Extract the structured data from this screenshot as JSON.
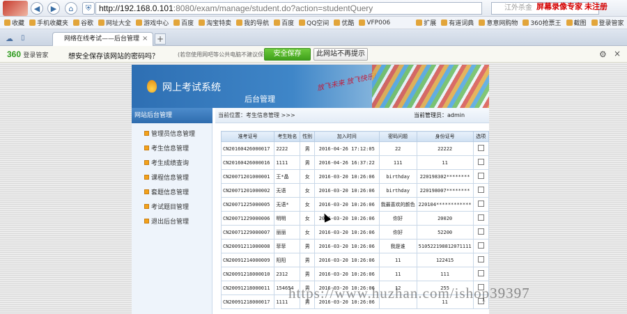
{
  "browser": {
    "url_host": "http://192.168.0.101",
    "url_rest": ":8080/exam/manage/student.do?action=studentQuery",
    "search_placeholder": "江外杀金",
    "watermark_top": "屏幕录像专家 未注册"
  },
  "bookmarks": [
    "收藏",
    "手机收藏夹",
    "谷歌",
    "网址大全",
    "游戏中心",
    "百度",
    "淘宝特卖",
    "我的导航",
    "百度",
    "QQ空间",
    "优酷",
    "VFP006",
    "扩展",
    "有道词典",
    "意意网购物",
    "360抢票王",
    "截图",
    "登录管家"
  ],
  "tab": {
    "title": "网络在线考试——后台管理",
    "close": "×",
    "new": "+"
  },
  "password_bar": {
    "brand": "360",
    "brand_sub": "登录管家",
    "question": "想安全保存该网站的密码吗？",
    "hint": "(若您使用网吧等公共电脑不建议保存)",
    "save_label": "安全保存",
    "never_label": "此网站不再提示"
  },
  "site": {
    "system_name": "网上考试系统",
    "backend_name": "后台管理",
    "slogan": "放飞未来 放飞快乐!",
    "menu_title": "网站后台管理",
    "menu": [
      "管理员信息管理",
      "考生信息管理",
      "考生成绩查询",
      "课程信息管理",
      "套题信息管理",
      "考试题目管理",
      "退出后台管理"
    ],
    "breadcrumb": "当前位置：考生信息管理 >>>",
    "admin": "当前管理员：admin"
  },
  "table": {
    "headers": [
      "准考证号",
      "考生姓名",
      "性别",
      "加入时间",
      "密码问题",
      "身份证号",
      "选项"
    ],
    "rows": [
      [
        "CN20160426000017",
        "2222",
        "男",
        "2016-04-26 17:12:05",
        "22",
        "22222"
      ],
      [
        "CN20160426000016",
        "1111",
        "男",
        "2016-04-26 16:37:22",
        "111",
        "11"
      ],
      [
        "CN20071201000001",
        "王*晶",
        "女",
        "2016-03-20 10:26:06",
        "birthday",
        "220198302********"
      ],
      [
        "CN20071201000002",
        "无语",
        "女",
        "2016-03-20 10:26:06",
        "birthday",
        "220198007********"
      ],
      [
        "CN20071225000005",
        "无语*",
        "女",
        "2016-03-20 10:26:06",
        "我最喜欢的颜色",
        "220104************"
      ],
      [
        "CN20071229000006",
        "明明",
        "女",
        "2016-03-20 10:26:06",
        "你好",
        "20020"
      ],
      [
        "CN20071229000007",
        "丽丽",
        "女",
        "2016-03-20 10:26:06",
        "你好",
        "52200"
      ],
      [
        "CN20091211000008",
        "菲菲",
        "男",
        "2016-03-20 10:26:06",
        "我是谁",
        "510522198812071111"
      ],
      [
        "CN20091214000009",
        "阳阳",
        "男",
        "2016-03-20 10:26:06",
        "11",
        "122415"
      ],
      [
        "CN20091218000010",
        "2312",
        "男",
        "2016-03-20 10:26:06",
        "11",
        "111"
      ],
      [
        "CN20091218000011",
        "154654",
        "男",
        "2016-03-20 10:26:06",
        "12",
        "255"
      ],
      [
        "CN20091218000017",
        "1111",
        "男",
        "2016-03-20 10:26:06",
        "",
        "11"
      ]
    ]
  },
  "watermark_bottom": "https://www.huzhan.com/ishop39397"
}
